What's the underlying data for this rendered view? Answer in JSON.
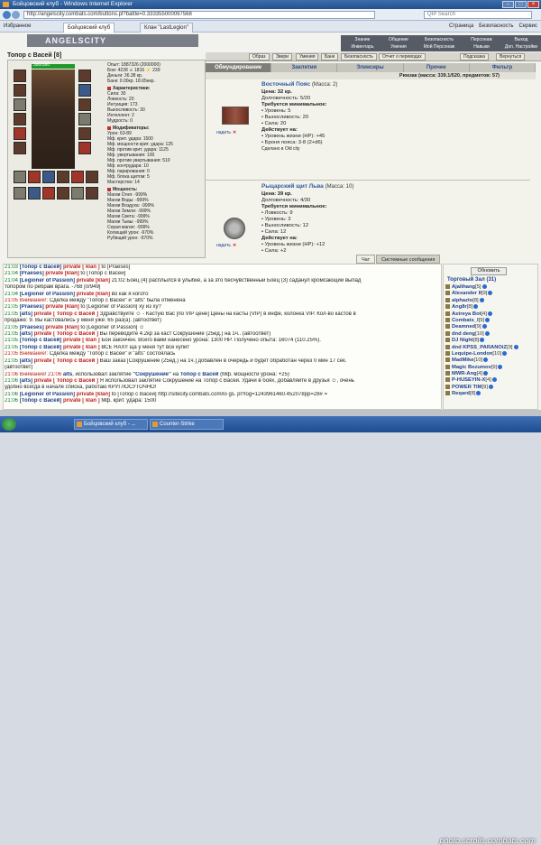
{
  "browser": {
    "title": "Бойцовский клуб - Windows Internet Explorer",
    "url": "http://angelscity.combats.com/buttons.pl?battle=0.333355000097568",
    "search_placeholder": "QIP Search",
    "favorites": "Избранное",
    "tabs": [
      "Бойцовский клуб",
      "Клан \"LastLegion\""
    ],
    "tools": [
      "Страница",
      "Безопасность",
      "Сервис"
    ]
  },
  "game": {
    "logo": "ANGELSCITY",
    "topmenu": [
      [
        "Знание",
        "Общение",
        "Безопасность",
        "Персонаж",
        "Выход"
      ],
      [
        "Инвентарь",
        "Умения",
        "Мой Персонаж",
        "Навыки",
        "Доп. Настройки"
      ]
    ],
    "gamebar": [
      "Образ",
      "Звери",
      "Умения",
      "Банк",
      "Безопасность",
      "Отчет о переводах",
      "Подсказка",
      "Вернуться"
    ],
    "character": {
      "name": "Топор с Васей",
      "level": "[8]",
      "hp": "380/380",
      "stats_top": [
        "Опыт: 1887326 (2000000)",
        "Бои: 4228 ⚔ 1816 ⚡ 239",
        "Деньги: 36.38 кр.",
        "Банк: 0.00кр. 18.65екр."
      ],
      "characteristics_title": "Характеристики:",
      "characteristics": [
        "Сила: 30",
        "Ловкость: 20",
        "Интуиция: 173",
        "Выносливость: 30",
        "Интеллект: 2",
        "Мудрость: 0"
      ],
      "modifiers_title": "Модификаторы:",
      "modifiers": [
        "Урон: 63-89",
        "Мф. крит. удара: 1500",
        "Мф. мощности крит. удара: 125",
        "Мф. против крит. удара: 1125",
        "Мф. увертывания: 100",
        "Мф. против увертывания: 510",
        "Мф. контрудара: 10",
        "Мф. парирования: 0",
        "Мф. блока щитом: 5",
        "Мастерство: 14"
      ],
      "magic_title": "Мощность:",
      "magic": [
        "Магии Огня: -999%",
        "Магии Воды: -999%",
        "Магии Воздуха: -999%",
        "Магии Земли: -999%",
        "Магии Света: -999%",
        "Магии Тьмы: -999%",
        "Серая магия: -999%",
        "Колющий урон: -970%",
        "Рубящий урон: -970%"
      ]
    },
    "shop": {
      "tabs": [
        "Обмундирование",
        "Заклятия",
        "Эликсиры",
        "Прочее",
        "Фильтр"
      ],
      "backpack": "Рюкзак (масса: 339.1/520, предметов: 57)",
      "items": [
        {
          "name": "Восточный Пояс",
          "mass": "(Масса: 2)",
          "action": "надеть",
          "lines": [
            "Цена: 32 кр.",
            "Долговечность: 5/20",
            "Требуется минимальное:",
            "• Уровень: 5",
            "• Выносливость: 20",
            "• Сила: 20",
            "Действует на:",
            "• Уровень жизни (HP): +45",
            "• Броня пояса: 3-8 (2+d6)",
            "Сделано в Old city"
          ]
        },
        {
          "name": "Рыцарский щит Льва",
          "mass": "(Масса: 10)",
          "action": "надеть",
          "lines": [
            "Цена: 39 кр.",
            "Долговечность: 4/30",
            "Требуется минимальное:",
            "• Ловкость: 9",
            "• Уровень: 3",
            "• Выносливость: 12",
            "• Сила: 12",
            "Действует на:",
            "• Уровень жизни (HP): +12",
            "• Сила: +2"
          ]
        }
      ]
    },
    "chat_tabs": [
      "Чат",
      "Системные сообщения"
    ],
    "chat": [
      {
        "t": "21:03",
        "parts": [
          [
            "n",
            "[Топор с Васей]"
          ],
          [
            "priv",
            " private [ klan ] "
          ],
          [
            "",
            "to [Praeses]"
          ]
        ]
      },
      {
        "t": "21:04",
        "parts": [
          [
            "n",
            "[Praeses]"
          ],
          [
            "priv",
            " private [klan] "
          ],
          [
            "",
            "to [Топор с Васей]"
          ]
        ]
      },
      {
        "t": "21:04",
        "parts": [
          [
            "n",
            "[Legioner of Passion]"
          ],
          [
            "priv",
            " private [klan] "
          ],
          [
            "",
            "21:02 Боец (4) расплылся в улыбке, а за это бесчувственный Боец (3) саданул кромсающий выпад"
          ]
        ]
      },
      {
        "t": "",
        "parts": [
          [
            "",
            "топором по ребрам врага. -768 [0/949]"
          ]
        ]
      },
      {
        "t": "21:04",
        "parts": [
          [
            "n",
            "[Legioner of Passion]"
          ],
          [
            "priv",
            " private [klan] "
          ],
          [
            "",
            "во как я когото"
          ]
        ]
      },
      {
        "t": "21:05",
        "tr": true,
        "parts": [
          [
            "tr",
            "Внимание!: "
          ],
          [
            "",
            "Сделка между \"Топор с Васей\" и \"alts\" была отменена"
          ]
        ]
      },
      {
        "t": "21:05",
        "parts": [
          [
            "n",
            "[Praeses]"
          ],
          [
            "priv",
            " private [klan] "
          ],
          [
            "",
            "to [Legioner of Passion] ху из ху?"
          ]
        ]
      },
      {
        "t": "21:05",
        "parts": [
          [
            "n",
            "[alts]"
          ],
          [
            "priv",
            " private [ Топор с Васей ] "
          ],
          [
            "",
            "Здравствуйте ☺ - Кастую Вас [по VIP цене] Цены на касты (VIP) в инфе, колонка VIP. Кол-во кастов в"
          ]
        ]
      },
      {
        "t": "",
        "parts": [
          [
            "",
            "продаже: 9. Вы кастовались у меня уже: 65 раз(а). (автоответ)"
          ]
        ]
      },
      {
        "t": "21:05",
        "parts": [
          [
            "n",
            "[Praeses]"
          ],
          [
            "priv",
            " private [klan] "
          ],
          [
            "",
            "to [Legioner of Passion] ☺"
          ]
        ]
      },
      {
        "t": "21:05",
        "parts": [
          [
            "n",
            "[alts]"
          ],
          [
            "priv",
            " private [ Топор с Васей ] "
          ],
          [
            "",
            "Вы переводите 4.2кр за каст Сокрушение (25ед.) на 1ч.. (автоответ)"
          ]
        ]
      },
      {
        "t": "21:05",
        "parts": [
          [
            "n",
            "[Топор с Васей]"
          ],
          [
            "priv",
            " private [ klan ] "
          ],
          [
            "",
            "Бой закончен. Всего вами нанесено урона: 1300 HP. Получено опыта: 16074 (110.25%)."
          ]
        ]
      },
      {
        "t": "21:05",
        "parts": [
          [
            "n",
            "[Топор с Васей]"
          ],
          [
            "priv",
            " private [ klan ] "
          ],
          [
            "",
            "ВСЕ НАХ!! ща у меня тут все купит"
          ]
        ]
      },
      {
        "t": "21:05",
        "tr": true,
        "parts": [
          [
            "tr",
            "Внимание!: "
          ],
          [
            "",
            "Сделка между \"Топор с Васей\" и \"alts\" состоялась"
          ]
        ]
      },
      {
        "t": "21:05",
        "parts": [
          [
            "n",
            "[alts]"
          ],
          [
            "priv",
            " private [ Топор с Васей ] "
          ],
          [
            "",
            "Ваш заказ [Сокрушение (25ед.) на 1ч.] добавлен в очередь и будет обработан через 0 мин 17 сек."
          ]
        ]
      },
      {
        "t": "",
        "parts": [
          [
            "",
            "(автоответ)"
          ]
        ]
      },
      {
        "t": "21:06",
        "tr": true,
        "parts": [
          [
            "tr",
            "Внимание! 21:06 "
          ],
          [
            "n",
            "alts"
          ],
          [
            "",
            ", использовал заклятие "
          ],
          [
            "n",
            "\"Сокрушение\""
          ],
          [
            "",
            " на "
          ],
          [
            "n",
            "Топор с Васей"
          ],
          [
            "",
            " (Мф. мощности урона: +25)"
          ]
        ]
      },
      {
        "t": "21:06",
        "parts": [
          [
            "n",
            "[alts]"
          ],
          [
            "priv",
            " private [ Топор с Васей ] "
          ],
          [
            "",
            "Я использовал заклятие Сокрушение на Топор с Васей. Удачи в боях, добавляйте в друзья ☺, очень"
          ]
        ]
      },
      {
        "t": "",
        "parts": [
          [
            "",
            "удобно всегда в начале списка, работаю КРУГЛОСУТОЧНО!"
          ]
        ]
      },
      {
        "t": "21:06",
        "parts": [
          [
            "n",
            "[Legioner of Passion]"
          ],
          [
            "priv",
            " private [klan] "
          ],
          [
            "",
            "to [Топор с Васей] http://sitecity.combats.com/lo gs. pl?log=1243961460.452078pp=28# ="
          ]
        ]
      },
      {
        "t": "21:06",
        "parts": [
          [
            "n",
            "[Топор с Васей]"
          ],
          [
            "priv",
            " private [ klan ] "
          ],
          [
            "",
            "Мф. крит. удара: 1500"
          ]
        ]
      }
    ],
    "online": {
      "refresh": "Обновить",
      "location": "Торговый Зал (31)",
      "users": [
        [
          "Ajalihang",
          "[5]"
        ],
        [
          "Alexander II",
          "[9]"
        ],
        [
          "alphazlo",
          "[8]"
        ],
        [
          "Ang8r",
          "[8]"
        ],
        [
          "Astreya Bot",
          "[4]"
        ],
        [
          "Combats_I",
          "[9]"
        ],
        [
          "Deamned",
          "[9]"
        ],
        [
          "dnd deng",
          "[10]"
        ],
        [
          "DJ Night",
          "[8]"
        ],
        [
          "dnd KPSS_PARANOiZ",
          "[9]"
        ],
        [
          "Lequipe-London",
          "[10]"
        ],
        [
          "MadMike",
          "[10]"
        ],
        [
          "Magic Bezumov",
          "[9]"
        ],
        [
          "MWR-Ang",
          "[4]"
        ],
        [
          "P-HUSEYIN-X",
          "[4]"
        ],
        [
          "POWER TIM",
          "[9]"
        ],
        [
          "Reqard",
          "[8]"
        ]
      ]
    }
  },
  "taskbar": {
    "items": [
      "Бойцовский клуб - ...",
      "Counter-Strike"
    ],
    "watermark": "photo.scrolls.combats.com"
  }
}
